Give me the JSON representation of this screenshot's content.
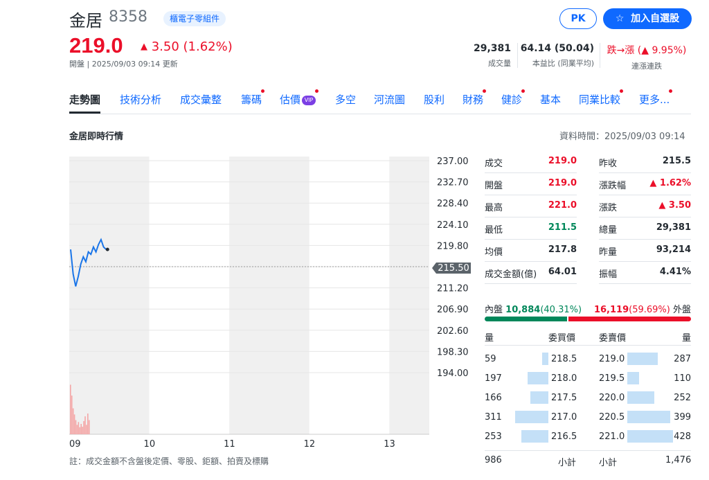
{
  "header": {
    "stock_name": "金居",
    "stock_code": "8358",
    "industry_tag": "櫃電子零組件",
    "price": "219.0",
    "change": "3.50 (1.62%)",
    "change_arrow": "▲",
    "status": "開盤 | 2025/09/03 09:14 更新",
    "pk_label": "PK",
    "watch_label": "加入自選股",
    "watch_icon": "star-icon"
  },
  "key_stats": [
    {
      "value": "29,381",
      "label": "成交量"
    },
    {
      "value": "64.14 (50.04)",
      "label": "本益比 (同業平均)"
    },
    {
      "value": "跌→漲 (▲ 9.95%)",
      "label": "連漲連跌"
    }
  ],
  "tabs": [
    {
      "label": "走勢圖",
      "active": true,
      "dot": false,
      "vip": false
    },
    {
      "label": "技術分析",
      "active": false,
      "dot": false,
      "vip": false
    },
    {
      "label": "成交彙整",
      "active": false,
      "dot": false,
      "vip": false
    },
    {
      "label": "籌碼",
      "active": false,
      "dot": true,
      "vip": false
    },
    {
      "label": "估價",
      "active": false,
      "dot": true,
      "vip": true
    },
    {
      "label": "多空",
      "active": false,
      "dot": false,
      "vip": false
    },
    {
      "label": "河流圖",
      "active": false,
      "dot": false,
      "vip": false
    },
    {
      "label": "股利",
      "active": false,
      "dot": false,
      "vip": false
    },
    {
      "label": "財務",
      "active": false,
      "dot": true,
      "vip": false
    },
    {
      "label": "健診",
      "active": false,
      "dot": true,
      "vip": false
    },
    {
      "label": "基本",
      "active": false,
      "dot": false,
      "vip": false
    },
    {
      "label": "同業比較",
      "active": false,
      "dot": true,
      "vip": false
    },
    {
      "label": "更多...",
      "active": false,
      "dot": true,
      "vip": false
    }
  ],
  "vip_badge": "VIP",
  "section": {
    "title": "金居即時行情",
    "data_time": "資料時間：2025/09/03 09:14",
    "note": "註：成交金額不含盤後定價、零股、鉅額、拍賣及標購"
  },
  "chart_data": {
    "type": "line",
    "y_ticks": [
      "237.00",
      "232.70",
      "228.40",
      "224.10",
      "219.80",
      "215.50",
      "211.20",
      "206.90",
      "202.60",
      "198.30",
      "194.00"
    ],
    "x_ticks": [
      "09",
      "10",
      "11",
      "12",
      "13"
    ],
    "reference_price": "215.50",
    "ylim": [
      194.0,
      237.0
    ],
    "price_series": {
      "time_min": [
        0,
        1,
        2,
        3,
        4,
        5,
        6,
        7,
        8,
        9,
        10,
        11,
        12,
        13,
        14
      ],
      "price": [
        219.0,
        214.0,
        211.5,
        213.5,
        216.0,
        217.5,
        216.5,
        218.5,
        218.0,
        219.5,
        218.5,
        220.0,
        221.0,
        219.5,
        219.0
      ]
    },
    "volume_series": {
      "time_min": [
        0,
        1,
        2,
        3,
        4,
        5,
        6,
        7,
        8,
        9,
        10,
        11,
        12,
        13,
        14
      ],
      "volume": [
        10.5,
        8.2,
        5.5,
        4.2,
        3.0,
        2.0,
        2.6,
        1.5,
        2.2,
        1.6,
        2.8,
        3.8,
        2.0,
        4.4,
        3.0
      ]
    },
    "colors": {
      "line": "#1a75e8",
      "volume": "#f4a6a6",
      "band": "#f0f0f0",
      "grid": "#e6e6e6"
    }
  },
  "quote_left": [
    {
      "label": "成交",
      "value": "219.0",
      "color": "red"
    },
    {
      "label": "開盤",
      "value": "219.0",
      "color": "red"
    },
    {
      "label": "最高",
      "value": "221.0",
      "color": "red"
    },
    {
      "label": "最低",
      "value": "211.5",
      "color": "green"
    },
    {
      "label": "均價",
      "value": "217.8",
      "color": "black"
    },
    {
      "label": "成交金額(億)",
      "value": "64.01",
      "color": "black"
    }
  ],
  "quote_right": [
    {
      "label": "昨收",
      "value": "215.5",
      "color": "black"
    },
    {
      "label": "漲跌幅",
      "value": "▲ 1.62%",
      "color": "red"
    },
    {
      "label": "漲跌",
      "value": "▲ 3.50",
      "color": "red"
    },
    {
      "label": "總量",
      "value": "29,381",
      "color": "black"
    },
    {
      "label": "昨量",
      "value": "93,214",
      "color": "black"
    },
    {
      "label": "振幅",
      "value": "4.41%",
      "color": "black"
    }
  ],
  "inner_outer": {
    "inner_label": "內盤",
    "inner_value": "10,884",
    "inner_pct": "(40.31%)",
    "outer_value": "16,119",
    "outer_pct": "(59.69%)",
    "outer_label": "外盤",
    "inner_fraction": 0.4031
  },
  "order_book": {
    "headers": {
      "bid_qty": "量",
      "bid_price": "委買價",
      "ask_price": "委賣價",
      "ask_qty": "量"
    },
    "rows": [
      {
        "bid_qty": "59",
        "bid_price": "218.5",
        "ask_price": "219.0",
        "ask_qty": "287"
      },
      {
        "bid_qty": "197",
        "bid_price": "218.0",
        "ask_price": "219.5",
        "ask_qty": "110"
      },
      {
        "bid_qty": "166",
        "bid_price": "217.5",
        "ask_price": "220.0",
        "ask_qty": "252"
      },
      {
        "bid_qty": "311",
        "bid_price": "217.0",
        "ask_price": "220.5",
        "ask_qty": "399"
      },
      {
        "bid_qty": "253",
        "bid_price": "216.5",
        "ask_price": "221.0",
        "ask_qty": "428"
      }
    ],
    "bid_total": "986",
    "bid_total_label": "小計",
    "ask_total_label": "小計",
    "ask_total": "1,476"
  }
}
